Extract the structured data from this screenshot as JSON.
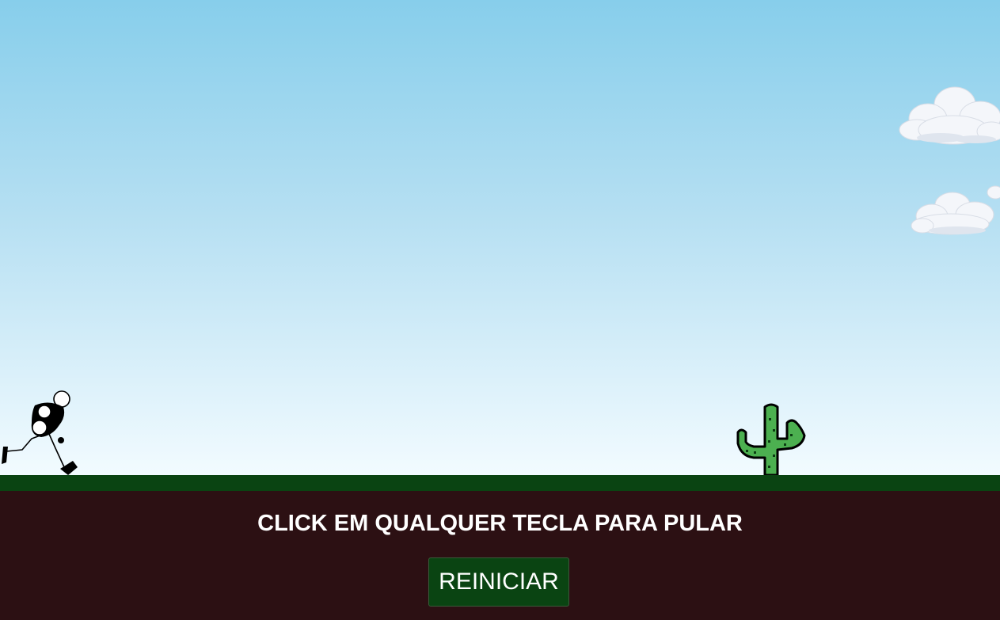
{
  "game": {
    "instruction": "CLICK EM QUALQUER TECLA PARA PULAR",
    "restart_label": "REINICIAR"
  },
  "sprites": {
    "player": "stick-runner",
    "obstacle": "cactus",
    "decorations": [
      "cloud",
      "cloud"
    ]
  },
  "colors": {
    "sky_top": "#87ceeb",
    "sky_bottom": "#f2fbff",
    "ground": "#0a4412",
    "footer": "#2c1013",
    "button": "#0a4412",
    "cactus": "#4cb050",
    "text": "#ffffff"
  }
}
